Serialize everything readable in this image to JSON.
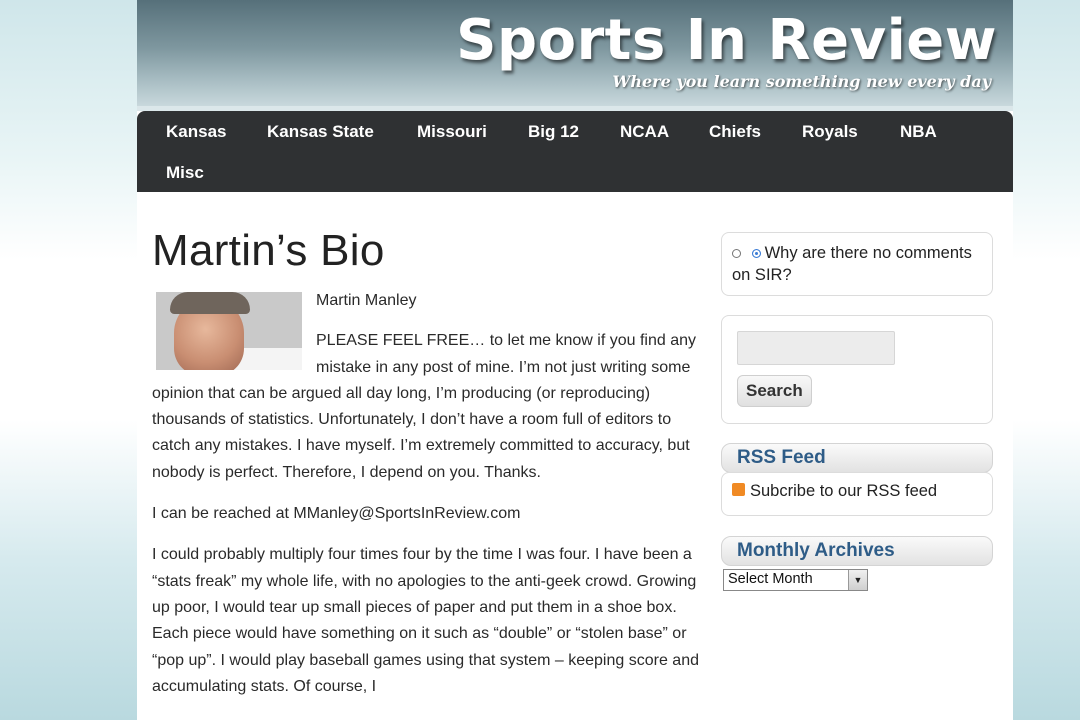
{
  "header": {
    "site_title": "Sports In Review",
    "tagline": "Where you learn something new every day"
  },
  "nav": {
    "items": [
      "Kansas",
      "Kansas State",
      "Missouri",
      "Big 12",
      "NCAA",
      "Chiefs",
      "Royals",
      "NBA",
      "Misc"
    ]
  },
  "post": {
    "title": "Martin’s Bio",
    "author_name": "Martin Manley",
    "paragraph1": "PLEASE FEEL FREE… to let me know if you find any mistake in any post of mine. I’m not just writing some opinion that can be argued all day long, I’m producing (or reproducing) thousands of statistics. Unfortunately, I don’t have a room full of editors to catch any mistakes. I have myself. I’m extremely committed to accuracy, but nobody is perfect. Therefore, I depend on you.  Thanks.",
    "paragraph2": "I can be reached at MManley@SportsInReview.com",
    "paragraph3": "I could probably multiply four times four by the time I was four. I have been a “stats freak” my whole life, with no apologies to the anti-geek crowd. Growing up poor, I would tear up small pieces of paper and put them in a shoe box. Each piece would have something on it such as “double” or “stolen base” or “pop up”. I would play baseball games using that system – keeping score and accumulating stats. Of course, I"
  },
  "sidebar": {
    "poll_text": "Why are there no comments on SIR?",
    "search_button": "Search",
    "rss": {
      "title": "RSS Feed",
      "link": "Subcribe to our RSS feed"
    },
    "archives": {
      "title": "Monthly Archives",
      "select_value": "Select Month"
    }
  },
  "colors": {
    "nav_bg": "#2f3133",
    "widget_title": "#2e5c87",
    "rss_orange": "#f08a24"
  }
}
